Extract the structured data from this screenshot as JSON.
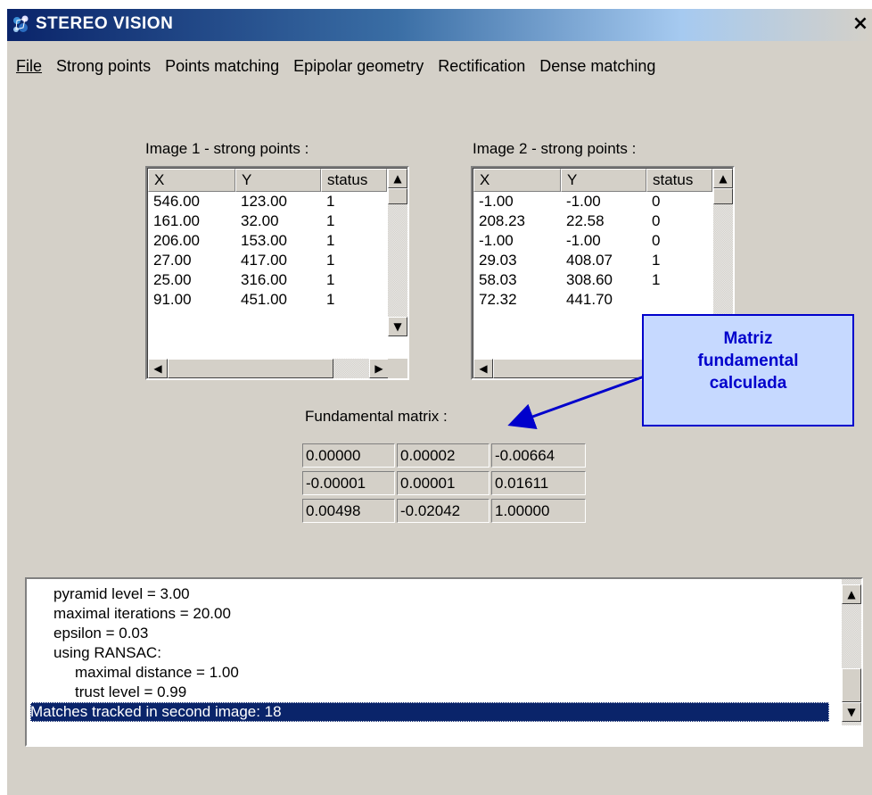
{
  "window": {
    "title": "STEREO VISION",
    "close_symbol": "×"
  },
  "menu": [
    "File",
    "Strong points",
    "Points matching",
    "Epipolar geometry",
    "Rectification",
    "Dense matching"
  ],
  "image1": {
    "title": "Image 1 - strong points :",
    "columns": [
      "X",
      "Y",
      "status"
    ],
    "rows": [
      [
        "546.00",
        "123.00",
        "1"
      ],
      [
        "161.00",
        "32.00",
        "1"
      ],
      [
        "206.00",
        "153.00",
        "1"
      ],
      [
        "27.00",
        "417.00",
        "1"
      ],
      [
        "25.00",
        "316.00",
        "1"
      ],
      [
        "91.00",
        "451.00",
        "1"
      ]
    ]
  },
  "image2": {
    "title": "Image 2 - strong points :",
    "columns": [
      "X",
      "Y",
      "status"
    ],
    "rows": [
      [
        "-1.00",
        "-1.00",
        "0"
      ],
      [
        "208.23",
        "22.58",
        "0"
      ],
      [
        "-1.00",
        "-1.00",
        "0"
      ],
      [
        "29.03",
        "408.07",
        "1"
      ],
      [
        "58.03",
        "308.60",
        "1"
      ],
      [
        "72.32",
        "441.70",
        ""
      ]
    ]
  },
  "fundamental_matrix": {
    "label": "Fundamental matrix :",
    "values": [
      [
        "0.00000",
        "0.00002",
        "-0.00664"
      ],
      [
        "-0.00001",
        "0.00001",
        "0.01611"
      ],
      [
        "0.00498",
        "-0.02042",
        "1.00000"
      ]
    ]
  },
  "log": {
    "lines": [
      {
        "text": "pyramid level = 3.00",
        "indent": 1
      },
      {
        "text": "maximal iterations = 20.00",
        "indent": 1
      },
      {
        "text": "epsilon = 0.03",
        "indent": 1
      },
      {
        "text": "using RANSAC:",
        "indent": 1
      },
      {
        "text": "maximal distance = 1.00",
        "indent": 2
      },
      {
        "text": "trust level = 0.99",
        "indent": 2
      },
      {
        "text": "Matches tracked in second image: 18",
        "indent": 0,
        "selected": true
      }
    ]
  },
  "annotation": {
    "lines": [
      "Matriz",
      "fundamental",
      "calculada"
    ],
    "color": "#0000cc",
    "background": "#c6d9ff"
  }
}
